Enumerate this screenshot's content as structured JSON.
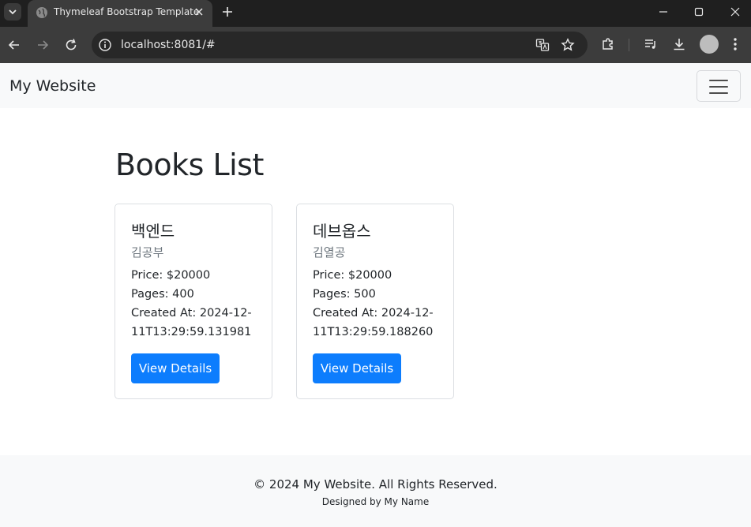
{
  "browser": {
    "tab_title": "Thymeleaf Bootstrap Template",
    "url": "localhost:8081/#"
  },
  "navbar": {
    "brand": "My Website"
  },
  "main": {
    "heading": "Books List",
    "books": [
      {
        "title": "백엔드",
        "author": "김공부",
        "price": "Price: $20000",
        "pages": "Pages: 400",
        "created_line1": "Created At: 2024-12-",
        "created_line2": "11T13:29:59.131981",
        "button": "View Details"
      },
      {
        "title": "데브옵스",
        "author": "김열공",
        "price": "Price: $20000",
        "pages": "Pages: 500",
        "created_line1": "Created At: 2024-12-",
        "created_line2": "11T13:29:59.188260",
        "button": "View Details"
      }
    ]
  },
  "footer": {
    "copyright": "© 2024 My Website. All Rights Reserved.",
    "credit": "Designed by My Name"
  },
  "icons": {
    "tab_search": "chevron-down-icon",
    "favicon": "globe-icon",
    "tab_close": "close-icon",
    "new_tab": "plus-icon",
    "back": "arrow-left-icon",
    "forward": "arrow-right-icon",
    "reload": "reload-icon",
    "site_info": "info-icon",
    "translate": "translate-icon",
    "bookmark": "star-icon",
    "extensions": "puzzle-icon",
    "media": "media-queue-icon",
    "downloads": "download-icon"
  },
  "colors": {
    "primary": "#0d7dfd",
    "navbar_bg": "#f8f9fa",
    "muted_text": "#6c757d"
  }
}
